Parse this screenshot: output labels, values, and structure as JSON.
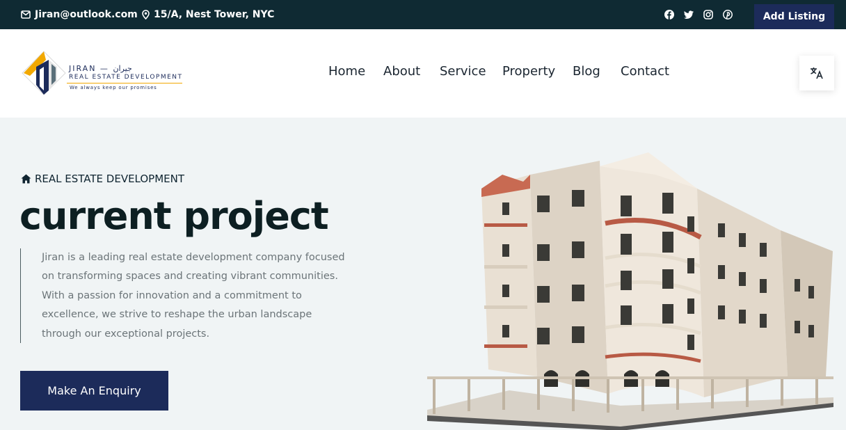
{
  "topbar": {
    "email": "Jiran@outlook.com",
    "address": "15/A, Nest Tower, NYC",
    "social_icons": [
      "facebook-icon",
      "twitter-icon",
      "instagram-icon",
      "pinterest-icon"
    ],
    "add_listing_label": "Add Listing"
  },
  "logo": {
    "title": "JIRAN — جيران",
    "subtitle": "REAL ESTATE DEVELOPMENT",
    "tagline": "We always keep our promises"
  },
  "nav": {
    "items": [
      "Home",
      "About",
      "Service",
      "Property",
      "Blog",
      "Contact"
    ]
  },
  "language_icon": "translate-icon",
  "hero": {
    "eyebrow": "REAL ESTATE DEVELOPMENT",
    "title": "current project",
    "description": "Jiran is a leading real estate development company focused on transforming spaces and creating vibrant communities. With a passion for innovation and a commitment to excellence, we strive to reshape the urban landscape through our exceptional projects.",
    "cta_label": "Make An Enquiry",
    "image": "building-illustration"
  },
  "colors": {
    "topbar_bg": "#0f2a33",
    "primary_navy": "#1c2b5a",
    "accent_orange": "#f2a800",
    "hero_bg": "#f0f4f5",
    "title_dark": "#0d1f22"
  }
}
